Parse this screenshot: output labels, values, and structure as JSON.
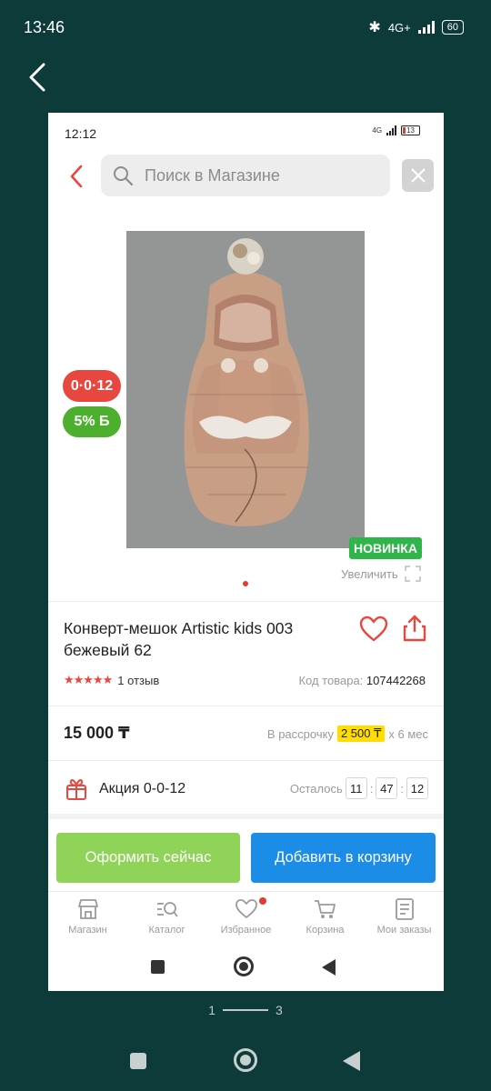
{
  "outer_status": {
    "time": "13:46",
    "network": "4G+",
    "battery": "60"
  },
  "inner_status": {
    "time": "12:12",
    "network": "4G",
    "battery": "13"
  },
  "search": {
    "placeholder": "Поиск в Магазине"
  },
  "badges": {
    "installment": "0·0·12",
    "bonus": "5% Б",
    "new": "НОВИНКА"
  },
  "zoom_label": "Увеличить",
  "product": {
    "title": "Конверт-мешок Artistic kids 003 бежевый 62",
    "reviews": "1 отзыв",
    "rating_stars": 5,
    "code_label": "Код товара:",
    "code": "107442268",
    "price": "15 000 ₸",
    "installment_prefix": "В рассрочку",
    "installment_amount": "2 500 ₸",
    "installment_suffix": "x 6 мес"
  },
  "promo": {
    "label": "Акция 0-0-12",
    "remaining_label": "Осталось",
    "hours": "11",
    "minutes": "47",
    "seconds": "12"
  },
  "buttons": {
    "buy_now": "Оформить сейчас",
    "add_to_cart": "Добавить в корзину"
  },
  "tabs": [
    {
      "label": "Магазин",
      "icon": "shop-icon"
    },
    {
      "label": "Каталог",
      "icon": "catalog-search-icon"
    },
    {
      "label": "Избранное",
      "icon": "heart-icon"
    },
    {
      "label": "Корзина",
      "icon": "cart-icon"
    },
    {
      "label": "Мои заказы",
      "icon": "orders-icon"
    }
  ],
  "pager": {
    "current": "1",
    "total": "3"
  },
  "colors": {
    "accent_red": "#e8473f",
    "green": "#8fd359",
    "blue": "#1c8de6",
    "background": "#0d3b3a"
  }
}
